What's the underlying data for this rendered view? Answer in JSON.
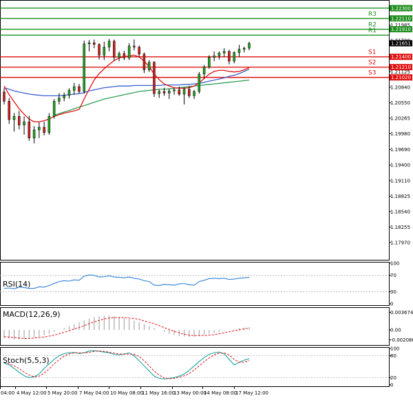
{
  "chart_data": [
    {
      "type": "candlestick",
      "ylim": [
        1.1765,
        1.2245
      ],
      "y_ticks": [
        "1.17970",
        "1.18255",
        "1.18540",
        "1.18825",
        "1.19110",
        "1.19400",
        "1.19690",
        "1.19980",
        "1.20265",
        "1.20550",
        "1.20840",
        "1.21125",
        "1.21410",
        "1.21700",
        "1.21985",
        "1.22270"
      ],
      "x_ticks": [
        "04:00",
        "4 May 12:00",
        "5 May 20:00",
        "7 May 04:00",
        "10 May 08:00",
        "11 May 16:00",
        "13 May 00:00",
        "14 May 08:00",
        "17 May 12:00"
      ],
      "levels": [
        {
          "name": "",
          "value": 1.223,
          "label": "1.22300",
          "color": "#1f8f1f"
        },
        {
          "name": "R3",
          "value": 1.2211,
          "label": "1.22110",
          "color": "#1f8f1f"
        },
        {
          "name": "R2",
          "value": 1.2191,
          "label": "1.21910",
          "color": "#1f8f1f"
        },
        {
          "name": "R1",
          "value": 1.218,
          "label": "",
          "color": "#1f8f1f"
        },
        {
          "name": "S1",
          "value": 1.214,
          "label": "1.21400",
          "color": "#e01010"
        },
        {
          "name": "S2",
          "value": 1.2121,
          "label": "1.21210",
          "color": "#e01010"
        },
        {
          "name": "S3",
          "value": 1.2102,
          "label": "1.21020",
          "color": "#e01010"
        }
      ],
      "current_price": "1.21651",
      "candles": [
        [
          1.2075,
          1.2082,
          1.2052,
          1.2058
        ],
        [
          1.2058,
          1.2064,
          1.2016,
          1.2024
        ],
        [
          1.2024,
          1.2036,
          1.2002,
          1.203
        ],
        [
          1.203,
          1.204,
          1.2006,
          1.2014
        ],
        [
          1.2014,
          1.203,
          1.1996,
          1.202
        ],
        [
          1.202,
          1.2031,
          1.1985,
          1.199
        ],
        [
          1.199,
          1.2012,
          1.198,
          1.2005
        ],
        [
          1.2005,
          1.2019,
          1.199,
          1.201
        ],
        [
          1.201,
          1.202,
          1.1995,
          1.2
        ],
        [
          1.2,
          1.2036,
          1.1996,
          1.203
        ],
        [
          1.203,
          1.2062,
          1.2026,
          1.2058
        ],
        [
          1.2058,
          1.2073,
          1.2052,
          1.2064
        ],
        [
          1.2064,
          1.2074,
          1.2058,
          1.2069
        ],
        [
          1.2069,
          1.2082,
          1.2063,
          1.2078
        ],
        [
          1.2078,
          1.2092,
          1.207,
          1.2085
        ],
        [
          1.2085,
          1.209,
          1.2073,
          1.2076
        ],
        [
          1.2076,
          1.217,
          1.2072,
          1.2164
        ],
        [
          1.2164,
          1.2171,
          1.215,
          1.2166
        ],
        [
          1.2166,
          1.2172,
          1.2156,
          1.2163
        ],
        [
          1.2163,
          1.2165,
          1.2135,
          1.2143
        ],
        [
          1.2143,
          1.2168,
          1.2134,
          1.2158
        ],
        [
          1.2158,
          1.2173,
          1.215,
          1.2169
        ],
        [
          1.2169,
          1.2172,
          1.2133,
          1.2139
        ],
        [
          1.2139,
          1.215,
          1.2132,
          1.2146
        ],
        [
          1.2146,
          1.2151,
          1.2134,
          1.2138
        ],
        [
          1.2138,
          1.2165,
          1.2134,
          1.216
        ],
        [
          1.216,
          1.2172,
          1.2152,
          1.2158
        ],
        [
          1.2158,
          1.2161,
          1.2139,
          1.2145
        ],
        [
          1.2145,
          1.2148,
          1.211,
          1.2116
        ],
        [
          1.2116,
          1.2134,
          1.2112,
          1.213
        ],
        [
          1.213,
          1.2132,
          1.2066,
          1.2072
        ],
        [
          1.2072,
          1.208,
          1.2064,
          1.2076
        ],
        [
          1.2076,
          1.2083,
          1.2068,
          1.2073
        ],
        [
          1.2073,
          1.2081,
          1.2062,
          1.2077
        ],
        [
          1.2077,
          1.2082,
          1.207,
          1.2079
        ],
        [
          1.2079,
          1.2085,
          1.2068,
          1.2071
        ],
        [
          1.2071,
          1.2083,
          1.2052,
          1.208
        ],
        [
          1.208,
          1.2086,
          1.2064,
          1.2068
        ],
        [
          1.2068,
          1.2079,
          1.2062,
          1.2076
        ],
        [
          1.2076,
          1.2112,
          1.2072,
          1.2108
        ],
        [
          1.2108,
          1.2125,
          1.21,
          1.2121
        ],
        [
          1.2121,
          1.2143,
          1.2118,
          1.2139
        ],
        [
          1.2139,
          1.215,
          1.2132,
          1.2142
        ],
        [
          1.2142,
          1.215,
          1.2135,
          1.2147
        ],
        [
          1.2147,
          1.2156,
          1.214,
          1.215
        ],
        [
          1.215,
          1.2153,
          1.2126,
          1.2132
        ],
        [
          1.2132,
          1.215,
          1.2128,
          1.2148
        ],
        [
          1.2148,
          1.2162,
          1.214,
          1.2154
        ],
        [
          1.2154,
          1.2159,
          1.2148,
          1.2156
        ],
        [
          1.2156,
          1.2168,
          1.2152,
          1.2165
        ]
      ],
      "ma_red": [
        1.2086,
        1.207,
        1.2057,
        1.2044,
        1.2034,
        1.2025,
        1.202,
        1.202,
        1.2022,
        1.2025,
        1.203,
        1.2033,
        1.2036,
        1.2038,
        1.204,
        1.2043,
        1.2062,
        1.208,
        1.2097,
        1.2109,
        1.2118,
        1.2126,
        1.2133,
        1.2138,
        1.214,
        1.2142,
        1.2143,
        1.214,
        1.2132,
        1.2122,
        1.2108,
        1.2098,
        1.209,
        1.2086,
        1.2083,
        1.2082,
        1.2082,
        1.2083,
        1.2086,
        1.2092,
        1.21,
        1.2108,
        1.2113,
        1.2115,
        1.2115,
        1.2113,
        1.2112,
        1.2113,
        1.2116,
        1.212
      ],
      "ma_blue": [
        1.2083,
        1.208,
        1.2077,
        1.2075,
        1.2073,
        1.2071,
        1.207,
        1.2069,
        1.2068,
        1.2068,
        1.2068,
        1.2068,
        1.2069,
        1.207,
        1.2071,
        1.2072,
        1.2074,
        1.2077,
        1.2079,
        1.2081,
        1.2083,
        1.2084,
        1.2085,
        1.2086,
        1.2086,
        1.2086,
        1.2087,
        1.2087,
        1.2087,
        1.2087,
        1.2087,
        1.2087,
        1.2088,
        1.2088,
        1.2088,
        1.2088,
        1.2089,
        1.2089,
        1.209,
        1.2091,
        1.2093,
        1.2095,
        1.2097,
        1.2099,
        1.2101,
        1.2104,
        1.2106,
        1.2109,
        1.2113,
        1.2117
      ],
      "ma_green": [
        null,
        null,
        null,
        null,
        null,
        null,
        null,
        null,
        null,
        null,
        1.2032,
        1.2035,
        1.2038,
        1.2041,
        1.2044,
        1.2047,
        1.205,
        1.2053,
        1.2056,
        1.2059,
        1.2062,
        1.2064,
        1.2066,
        1.2068,
        1.207,
        1.2072,
        1.2074,
        1.2076,
        1.2077,
        1.2078,
        1.2079,
        1.208,
        1.208,
        1.2081,
        1.2082,
        1.2083,
        1.2084,
        1.2085,
        1.2086,
        1.2087,
        1.2088,
        1.2089,
        1.209,
        1.2091,
        1.2092,
        1.2093,
        1.2094,
        1.2095,
        1.2096,
        1.2097
      ]
    },
    {
      "type": "line",
      "title": "RSI(14)",
      "ylim": [
        0,
        100
      ],
      "y_ticks": [
        "100",
        "70",
        "30",
        "0"
      ],
      "values": [
        38,
        39,
        37,
        41,
        40,
        38,
        38,
        42,
        41,
        45,
        50,
        55,
        57,
        56,
        59,
        58,
        68,
        71,
        70,
        66,
        67,
        69,
        66,
        65,
        64,
        66,
        63,
        61,
        57,
        55,
        46,
        45,
        48,
        47,
        46,
        49,
        50,
        47,
        46,
        55,
        58,
        62,
        63,
        62,
        63,
        60,
        61,
        63,
        64,
        65
      ]
    },
    {
      "type": "bar",
      "title": "MACD(12,26,9)",
      "ylim": [
        -0.0026,
        0.0042
      ],
      "y_ticks": [
        "0.003674",
        "0.00",
        "-0.002086"
      ],
      "values": [
        -0.0018,
        -0.0019,
        -0.002,
        -0.002,
        -0.0019,
        -0.0018,
        -0.0016,
        -0.0014,
        -0.0011,
        -0.0008,
        -0.0004,
        0.0,
        0.0004,
        0.0008,
        0.0012,
        0.0016,
        0.002,
        0.0024,
        0.0027,
        0.0029,
        0.003,
        0.003,
        0.0029,
        0.0027,
        0.0025,
        0.0023,
        0.002,
        0.0016,
        0.0012,
        0.0008,
        0.0004,
        0.0,
        -0.0004,
        -0.0008,
        -0.0011,
        -0.0013,
        -0.0014,
        -0.0015,
        -0.0014,
        -0.0012,
        -0.001,
        -0.0008,
        -0.0006,
        -0.0004,
        -0.0002,
        0.0,
        0.0002,
        0.0004,
        0.0005,
        0.0006
      ],
      "signal": [
        -0.0014,
        -0.0015,
        -0.0016,
        -0.0017,
        -0.0018,
        -0.0018,
        -0.0017,
        -0.0016,
        -0.0015,
        -0.0013,
        -0.0011,
        -0.0008,
        -0.0005,
        -0.0002,
        0.0002,
        0.0005,
        0.0009,
        0.0013,
        0.0017,
        0.002,
        0.0023,
        0.0025,
        0.0026,
        0.0026,
        0.0026,
        0.0025,
        0.0024,
        0.0022,
        0.0019,
        0.0016,
        0.0013,
        0.0009,
        0.0005,
        0.0001,
        -0.0003,
        -0.0006,
        -0.0009,
        -0.0011,
        -0.0012,
        -0.0012,
        -0.0012,
        -0.0011,
        -0.001,
        -0.0008,
        -0.0006,
        -0.0004,
        -0.0002,
        0.0,
        0.0002,
        0.0004
      ]
    },
    {
      "type": "line",
      "title": "Stoch(5,5,3)",
      "ylim": [
        0,
        100
      ],
      "y_ticks": [
        "100",
        "80",
        "20",
        "0"
      ],
      "k": [
        60,
        55,
        45,
        35,
        25,
        20,
        22,
        30,
        45,
        58,
        70,
        80,
        86,
        88,
        89,
        86,
        88,
        93,
        94,
        92,
        90,
        88,
        84,
        82,
        85,
        88,
        80,
        66,
        52,
        38,
        24,
        18,
        16,
        18,
        20,
        24,
        30,
        40,
        52,
        64,
        75,
        84,
        88,
        90,
        85,
        70,
        55,
        62,
        68,
        72
      ],
      "d": [
        62,
        58,
        52,
        45,
        35,
        27,
        22,
        24,
        32,
        44,
        58,
        69,
        79,
        85,
        88,
        88,
        88,
        89,
        92,
        93,
        92,
        90,
        87,
        85,
        84,
        85,
        84,
        78,
        66,
        52,
        38,
        27,
        19,
        17,
        18,
        21,
        25,
        31,
        41,
        52,
        64,
        74,
        82,
        87,
        88,
        82,
        70,
        62,
        62,
        67
      ]
    }
  ]
}
